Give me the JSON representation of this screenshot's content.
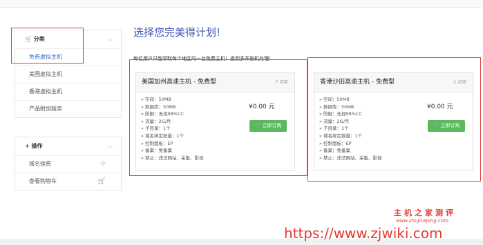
{
  "sidebar_categories": {
    "title": "分类",
    "items": [
      {
        "label": "免费虚拟主机"
      },
      {
        "label": "美国虚拟主机"
      },
      {
        "label": "香港虚拟主机"
      },
      {
        "label": "产品附加服务"
      }
    ]
  },
  "sidebar_actions": {
    "title": "操作",
    "items": [
      {
        "label": "域名续费"
      },
      {
        "label": "查看购物车"
      }
    ]
  },
  "main": {
    "title": "选择您完美得计划!",
    "notice": "每位用户只能领取每个地区的一台免费主机！查到多开删机处理！"
  },
  "products": [
    {
      "name": "美国加州高速主机 - 免费型",
      "available": "7 可用",
      "features": [
        "空间：50MB",
        "数据库：50MB",
        "防御：无视98%CC",
        "流量：2G/月",
        "子目录：1个",
        "域名绑定数量：1个",
        "控制面板：EP",
        "备案：免备案",
        "禁止：违法网站、采集、影视"
      ],
      "price": "¥0.00 元",
      "order_label": "立即订购"
    },
    {
      "name": "香港沙田高速主机 - 免费型",
      "available": "2 可用",
      "features": [
        "空间：50MB",
        "数据库：50MB",
        "防御：无视98%CC",
        "流量：2G/月",
        "子目录：1个",
        "域名绑定数量：1个",
        "控制面板：EP",
        "备案：免备案",
        "禁止：违法网站、采集、影视"
      ],
      "price": "¥0.00 元",
      "order_label": "立即订购"
    }
  ],
  "watermark": {
    "cn": "主机之家测评",
    "en": "www.zhujiceping.com",
    "url": "https://www.zjwiki.com"
  },
  "colors": {
    "accent": "#3f51b5",
    "link": "#2a6ec7",
    "button": "#5cb85c",
    "highlight": "#e53935"
  }
}
